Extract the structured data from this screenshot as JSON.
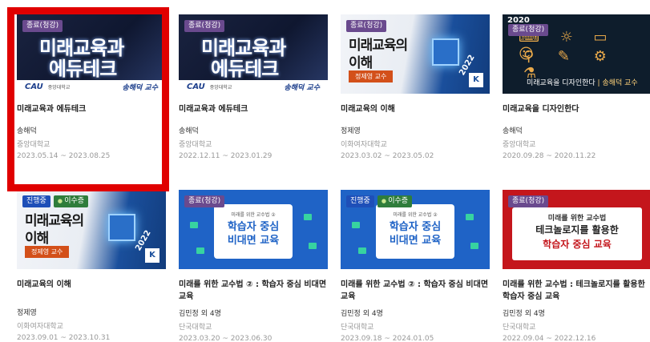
{
  "cards": [
    {
      "status_label": "종료(청강)",
      "thumb_line1": "미래교육과",
      "thumb_line2": "에듀테크",
      "thumb_logo": "CAU",
      "thumb_univ": "중앙대학교",
      "thumb_prof": "송해덕 교수",
      "title": "미래교육과 에듀테크",
      "instructor": "송해덕",
      "university": "중앙대학교",
      "dates": "2023.05.14 ~ 2023.08.25"
    },
    {
      "status_label": "종료(청강)",
      "thumb_line1": "미래교육과",
      "thumb_line2": "에듀테크",
      "thumb_logo": "CAU",
      "thumb_univ": "중앙대학교",
      "thumb_prof": "송해덕 교수",
      "title": "미래교육과 에듀테크",
      "instructor": "송해덕",
      "university": "중앙대학교",
      "dates": "2022.12.11 ~ 2023.01.29"
    },
    {
      "status_label": "종료(청강)",
      "thumb_line1": "미래교육의",
      "thumb_line2": "이해",
      "thumb_prof": "정제영 교수",
      "thumb_year": "2022",
      "title": "미래교육의 이해",
      "instructor": "정제영",
      "university": "이화여자대학교",
      "dates": "2023.03.02 ~ 2023.05.02"
    },
    {
      "thumb_year": "2020",
      "status_label": "종료(청강)",
      "thumb_caption_main": "미래교육을 디자인한다",
      "thumb_caption_prof": "송해덕 교수",
      "title": "미래교육을 디자인한다",
      "instructor": "송해덕",
      "university": "중앙대학교",
      "dates": "2020.09.28 ~ 2020.11.22"
    },
    {
      "status_label": "진행중",
      "completion_label": "이수증",
      "thumb_line1": "미래교육의",
      "thumb_line2": "이해",
      "thumb_prof": "정제영 교수",
      "thumb_year": "2022",
      "title": "미래교육의 이해",
      "instructor": "정제영",
      "university": "이화여자대학교",
      "dates": "2023.09.01 ~ 2023.10.31"
    },
    {
      "status_label": "종료(청강)",
      "thumb_top": "미래를 위한 교수법 ②",
      "thumb_line1": "학습자 중심",
      "thumb_line2": "비대면 교육",
      "title": "미래를 위한 교수법 ② : 학습자 중심 비대면 교육",
      "instructor": "김민정 외 4명",
      "university": "단국대학교",
      "dates": "2023.03.20 ~ 2023.06.30"
    },
    {
      "status_label": "진행중",
      "completion_label": "이수증",
      "thumb_top": "미래를 위한 교수법 ②",
      "thumb_line1": "학습자 중심",
      "thumb_line2": "비대면 교육",
      "title": "미래를 위한 교수법 ② : 학습자 중심 비대면 교육",
      "instructor": "김민정 외 4명",
      "university": "단국대학교",
      "dates": "2023.09.18 ~ 2024.01.05"
    },
    {
      "status_label": "종료(청강)",
      "thumb_top": "미래를 위한 교수법",
      "thumb_line1": "테크놀로지를 활용한",
      "thumb_line2": "학습자 중심 교육",
      "title": "미래를 위한 교수법 : 테크놀로지를 활용한 학습자 중심 교육",
      "instructor": "김민정 외 4명",
      "university": "단국대학교",
      "dates": "2022.09.04 ~ 2022.12.16"
    }
  ],
  "colors": {
    "highlight": "#e00000",
    "badge_ended": "#6a4a8e",
    "badge_in_progress": "#1e4fb8",
    "badge_certificate": "#2f7d3b"
  }
}
